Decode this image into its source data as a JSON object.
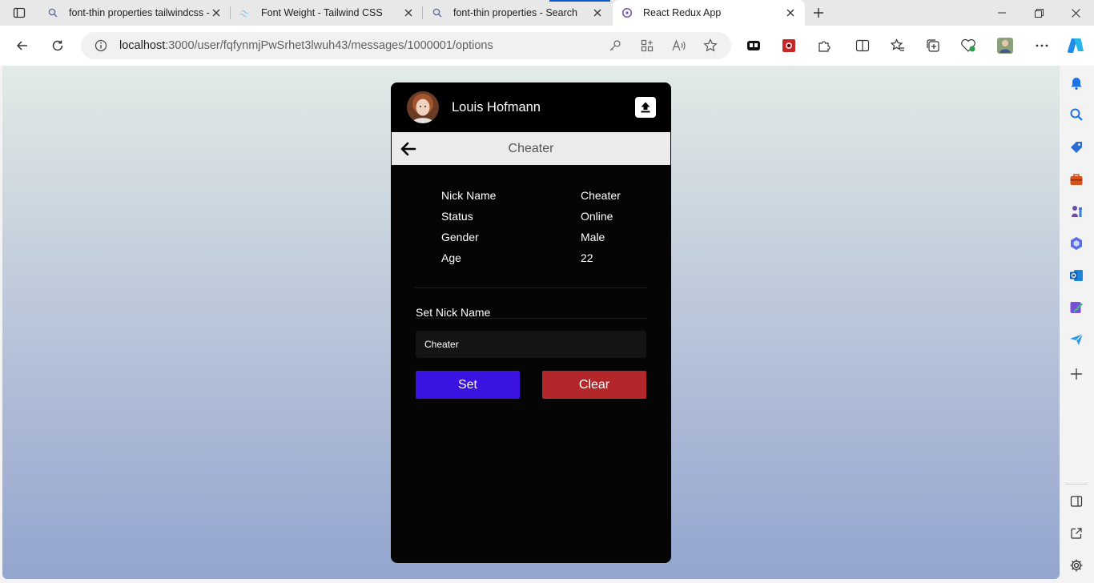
{
  "browser": {
    "tabs": [
      {
        "title": "font-thin properties tailwindcss -",
        "icon": "search-icon"
      },
      {
        "title": "Font Weight - Tailwind CSS",
        "icon": "tailwind-logo-icon"
      },
      {
        "title": "font-thin properties - Search",
        "icon": "search-icon"
      },
      {
        "title": "React Redux App",
        "icon": "redux-logo-icon",
        "active": true
      }
    ],
    "url_host": "localhost",
    "url_rest": ":3000/user/fqfynmjPwSrhet3lwuh43/messages/1000001/options",
    "accent": "#0c59c8"
  },
  "app": {
    "header": {
      "username": "Louis Hofmann"
    },
    "subbar": {
      "title": "Cheater"
    },
    "info": [
      {
        "label": "Nick Name",
        "value": "Cheater"
      },
      {
        "label": "Status",
        "value": "Online"
      },
      {
        "label": "Gender",
        "value": "Male"
      },
      {
        "label": "Age",
        "value": "22"
      }
    ],
    "set_nick": {
      "label": "Set Nick Name",
      "value": "Cheater",
      "set_label": "Set",
      "clear_label": "Clear",
      "set_color": "#3a13e0",
      "clear_color": "#b3262a"
    }
  }
}
